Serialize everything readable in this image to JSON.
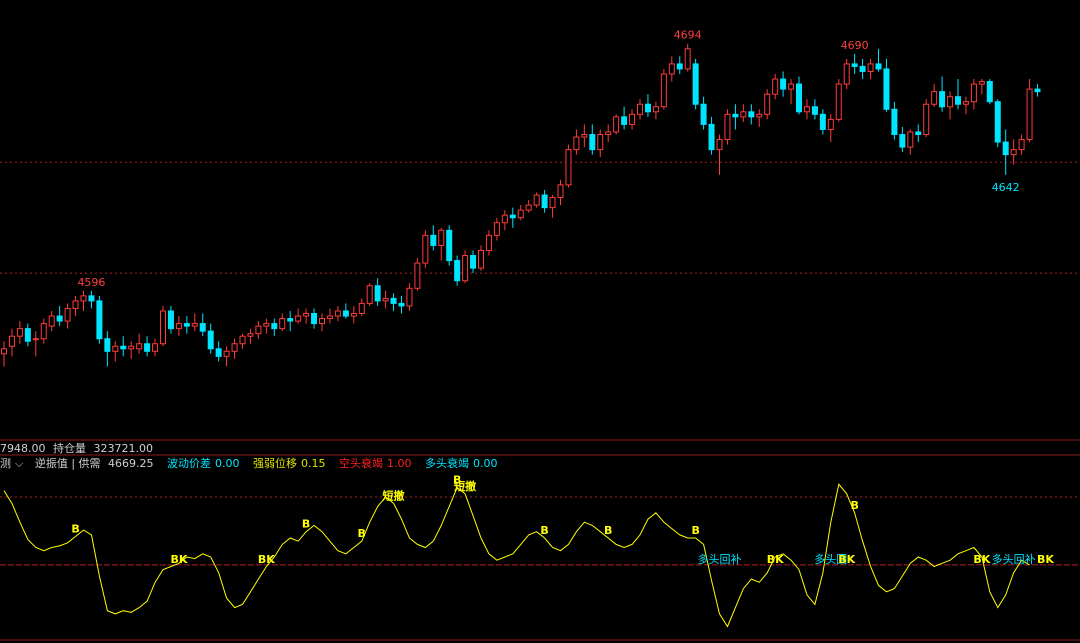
{
  "colors": {
    "background": "#000000",
    "up_candle": "#ff3b3b",
    "down_candle": "#00e5ff",
    "indicator_line": "#ffff00",
    "signal_text": "#ffff00",
    "ref_line": "#b02020",
    "label_white": "#cfcfcf",
    "label_yellow": "#e0e000",
    "label_red": "#ff2020",
    "label_cyan": "#00e5ff"
  },
  "info_bar": {
    "volume_text": "7948.00",
    "open_interest_label": "持仓量",
    "open_interest_value": "323721.00",
    "indicator_name": "测",
    "indicator_arrow": "⌵",
    "indicator_value_label": "逆振值 | 供需",
    "indicator_value": "4669.25",
    "fields": [
      {
        "label": "波动价差",
        "value": "0.00",
        "color": "#00e5ff"
      },
      {
        "label": "强弱位移",
        "value": "0.15",
        "color": "#e0e000"
      },
      {
        "label": "空头衰竭",
        "value": "1.00",
        "color": "#ff2020"
      },
      {
        "label": "多头衰竭",
        "value": "0.00",
        "color": "#00e5ff"
      }
    ]
  },
  "chart_data": [
    {
      "type": "candlestick",
      "price_range": [
        4540,
        4705
      ],
      "price_labels": [
        {
          "index": 11,
          "value": 4596,
          "text": "4596",
          "color": "#ff4040"
        },
        {
          "index": 86,
          "value": 4694,
          "text": "4694",
          "color": "#ff4040"
        },
        {
          "index": 107,
          "value": 4690,
          "text": "4690",
          "color": "#ff4040"
        },
        {
          "index": 126,
          "value": 4642,
          "text": "4642",
          "color": "#00e5ff"
        }
      ],
      "reference_lines": [
        4647,
        4603
      ],
      "candles": [
        [
          4571,
          4576,
          4566,
          4573
        ],
        [
          4574,
          4581,
          4570,
          4578
        ],
        [
          4578,
          4584,
          4575,
          4581
        ],
        [
          4581,
          4583,
          4574,
          4576
        ],
        [
          4577,
          4580,
          4570,
          4577
        ],
        [
          4577,
          4585,
          4575,
          4583
        ],
        [
          4582,
          4588,
          4580,
          4586
        ],
        [
          4586,
          4590,
          4582,
          4584
        ],
        [
          4584,
          4591,
          4581,
          4589
        ],
        [
          4589,
          4594,
          4586,
          4592
        ],
        [
          4592,
          4596,
          4588,
          4594
        ],
        [
          4594,
          4596,
          4589,
          4592
        ],
        [
          4592,
          4594,
          4575,
          4577
        ],
        [
          4577,
          4580,
          4566,
          4572
        ],
        [
          4572,
          4576,
          4568,
          4574
        ],
        [
          4574,
          4578,
          4570,
          4573
        ],
        [
          4573,
          4576,
          4569,
          4574
        ],
        [
          4573,
          4579,
          4571,
          4575
        ],
        [
          4575,
          4578,
          4570,
          4572
        ],
        [
          4572,
          4577,
          4570,
          4575
        ],
        [
          4575,
          4590,
          4574,
          4588
        ],
        [
          4588,
          4590,
          4579,
          4581
        ],
        [
          4581,
          4586,
          4578,
          4583
        ],
        [
          4583,
          4586,
          4579,
          4582
        ],
        [
          4582,
          4587,
          4580,
          4583
        ],
        [
          4583,
          4587,
          4578,
          4580
        ],
        [
          4580,
          4583,
          4571,
          4573
        ],
        [
          4573,
          4576,
          4568,
          4570
        ],
        [
          4570,
          4574,
          4566,
          4572
        ],
        [
          4572,
          4577,
          4569,
          4575
        ],
        [
          4575,
          4579,
          4573,
          4578
        ],
        [
          4578,
          4581,
          4575,
          4579
        ],
        [
          4579,
          4584,
          4577,
          4582
        ],
        [
          4582,
          4585,
          4579,
          4583
        ],
        [
          4583,
          4585,
          4578,
          4581
        ],
        [
          4581,
          4587,
          4580,
          4585
        ],
        [
          4585,
          4588,
          4580,
          4584
        ],
        [
          4584,
          4589,
          4583,
          4586
        ],
        [
          4586,
          4589,
          4583,
          4587
        ],
        [
          4587,
          4589,
          4581,
          4583
        ],
        [
          4583,
          4587,
          4580,
          4585
        ],
        [
          4585,
          4589,
          4583,
          4586
        ],
        [
          4586,
          4590,
          4584,
          4588
        ],
        [
          4588,
          4591,
          4585,
          4586
        ],
        [
          4586,
          4590,
          4583,
          4587
        ],
        [
          4587,
          4593,
          4586,
          4591
        ],
        [
          4591,
          4599,
          4590,
          4598
        ],
        [
          4598,
          4601,
          4590,
          4592
        ],
        [
          4592,
          4596,
          4589,
          4593
        ],
        [
          4593,
          4595,
          4588,
          4591
        ],
        [
          4591,
          4594,
          4587,
          4590
        ],
        [
          4590,
          4599,
          4588,
          4597
        ],
        [
          4597,
          4609,
          4596,
          4607
        ],
        [
          4607,
          4620,
          4605,
          4618
        ],
        [
          4618,
          4622,
          4612,
          4614
        ],
        [
          4614,
          4621,
          4608,
          4620
        ],
        [
          4620,
          4622,
          4606,
          4608
        ],
        [
          4608,
          4610,
          4598,
          4600
        ],
        [
          4600,
          4612,
          4599,
          4610
        ],
        [
          4610,
          4612,
          4603,
          4605
        ],
        [
          4605,
          4614,
          4604,
          4612
        ],
        [
          4612,
          4620,
          4610,
          4618
        ],
        [
          4618,
          4625,
          4616,
          4623
        ],
        [
          4623,
          4628,
          4620,
          4626
        ],
        [
          4626,
          4629,
          4621,
          4625
        ],
        [
          4625,
          4630,
          4624,
          4628
        ],
        [
          4628,
          4632,
          4627,
          4630
        ],
        [
          4630,
          4635,
          4629,
          4634
        ],
        [
          4634,
          4636,
          4627,
          4629
        ],
        [
          4629,
          4634,
          4625,
          4633
        ],
        [
          4633,
          4640,
          4630,
          4638
        ],
        [
          4638,
          4654,
          4637,
          4652
        ],
        [
          4652,
          4660,
          4650,
          4657
        ],
        [
          4657,
          4662,
          4653,
          4658
        ],
        [
          4658,
          4662,
          4650,
          4652
        ],
        [
          4652,
          4660,
          4649,
          4658
        ],
        [
          4658,
          4662,
          4655,
          4659
        ],
        [
          4659,
          4666,
          4658,
          4665
        ],
        [
          4665,
          4669,
          4660,
          4662
        ],
        [
          4662,
          4668,
          4660,
          4666
        ],
        [
          4666,
          4672,
          4664,
          4670
        ],
        [
          4670,
          4674,
          4665,
          4667
        ],
        [
          4667,
          4671,
          4664,
          4669
        ],
        [
          4669,
          4684,
          4668,
          4682
        ],
        [
          4682,
          4689,
          4679,
          4686
        ],
        [
          4686,
          4689,
          4682,
          4684
        ],
        [
          4684,
          4694,
          4683,
          4692
        ],
        [
          4686,
          4688,
          4668,
          4670
        ],
        [
          4670,
          4673,
          4660,
          4662
        ],
        [
          4662,
          4665,
          4650,
          4652
        ],
        [
          4652,
          4658,
          4642,
          4656
        ],
        [
          4656,
          4668,
          4654,
          4666
        ],
        [
          4666,
          4670,
          4660,
          4665
        ],
        [
          4665,
          4670,
          4663,
          4667
        ],
        [
          4667,
          4670,
          4662,
          4665
        ],
        [
          4665,
          4668,
          4661,
          4666
        ],
        [
          4666,
          4676,
          4664,
          4674
        ],
        [
          4674,
          4682,
          4672,
          4680
        ],
        [
          4680,
          4683,
          4673,
          4676
        ],
        [
          4676,
          4680,
          4670,
          4678
        ],
        [
          4678,
          4681,
          4666,
          4667
        ],
        [
          4667,
          4672,
          4664,
          4669
        ],
        [
          4669,
          4672,
          4664,
          4666
        ],
        [
          4666,
          4668,
          4658,
          4660
        ],
        [
          4660,
          4666,
          4655,
          4664
        ],
        [
          4664,
          4680,
          4663,
          4678
        ],
        [
          4678,
          4688,
          4676,
          4686
        ],
        [
          4686,
          4690,
          4682,
          4685
        ],
        [
          4685,
          4688,
          4680,
          4683
        ],
        [
          4683,
          4688,
          4680,
          4686
        ],
        [
          4686,
          4692,
          4683,
          4684
        ],
        [
          4684,
          4688,
          4667,
          4668
        ],
        [
          4668,
          4671,
          4656,
          4658
        ],
        [
          4658,
          4661,
          4651,
          4653
        ],
        [
          4653,
          4660,
          4650,
          4659
        ],
        [
          4659,
          4662,
          4655,
          4658
        ],
        [
          4658,
          4672,
          4657,
          4670
        ],
        [
          4670,
          4678,
          4669,
          4675
        ],
        [
          4675,
          4681,
          4667,
          4669
        ],
        [
          4669,
          4675,
          4664,
          4673
        ],
        [
          4673,
          4680,
          4668,
          4670
        ],
        [
          4670,
          4673,
          4666,
          4671
        ],
        [
          4671,
          4680,
          4668,
          4678
        ],
        [
          4678,
          4680,
          4674,
          4679
        ],
        [
          4679,
          4680,
          4670,
          4671
        ],
        [
          4671,
          4672,
          4653,
          4655
        ],
        [
          4655,
          4660,
          4642,
          4650
        ],
        [
          4650,
          4656,
          4646,
          4652
        ],
        [
          4652,
          4658,
          4650,
          4656
        ],
        [
          4656,
          4680,
          4655,
          4676
        ],
        [
          4676,
          4678,
          4673,
          4675
        ]
      ]
    },
    {
      "type": "line",
      "name": "逆振值",
      "y_range": [
        0,
        100
      ],
      "zero_line_value": 45,
      "top_ref_value": 88,
      "values": [
        92,
        84,
        72,
        61,
        56,
        54,
        56,
        57,
        59,
        63,
        67,
        64,
        38,
        16,
        14,
        16,
        15,
        18,
        22,
        34,
        42,
        44,
        46,
        50,
        49,
        52,
        50,
        40,
        24,
        18,
        20,
        28,
        36,
        44,
        50,
        58,
        62,
        60,
        66,
        70,
        66,
        60,
        54,
        52,
        56,
        60,
        72,
        82,
        88,
        84,
        74,
        62,
        58,
        56,
        60,
        70,
        82,
        94,
        90,
        76,
        62,
        52,
        48,
        50,
        52,
        58,
        64,
        66,
        62,
        56,
        54,
        58,
        66,
        72,
        70,
        66,
        62,
        58,
        56,
        58,
        64,
        74,
        78,
        72,
        68,
        64,
        62,
        62,
        58,
        35,
        14,
        6,
        18,
        30,
        36,
        34,
        40,
        50,
        52,
        48,
        42,
        26,
        20,
        40,
        72,
        96,
        90,
        78,
        60,
        44,
        32,
        28,
        30,
        38,
        46,
        50,
        48,
        44,
        46,
        48,
        52,
        54,
        56,
        50,
        28,
        18,
        26,
        40,
        48,
        45
      ],
      "signals": [
        {
          "index": 9,
          "text": "B",
          "pos": "above"
        },
        {
          "index": 22,
          "text": "BK",
          "pos": "below"
        },
        {
          "index": 33,
          "text": "BK",
          "pos": "below"
        },
        {
          "index": 38,
          "text": "B",
          "pos": "above"
        },
        {
          "index": 45,
          "text": "B",
          "pos": "above"
        },
        {
          "index": 49,
          "text": "短撤",
          "pos": "above"
        },
        {
          "index": 57,
          "text": "B",
          "pos": "above"
        },
        {
          "index": 58,
          "text": "短撤",
          "pos": "above"
        },
        {
          "index": 68,
          "text": "B",
          "pos": "above"
        },
        {
          "index": 76,
          "text": "B",
          "pos": "above"
        },
        {
          "index": 87,
          "text": "B",
          "pos": "above"
        },
        {
          "index": 97,
          "text": "BK",
          "pos": "below"
        },
        {
          "index": 107,
          "text": "B",
          "pos": "above"
        },
        {
          "index": 106,
          "text": "BK",
          "pos": "below"
        },
        {
          "index": 123,
          "text": "BK",
          "pos": "below"
        },
        {
          "index": 131,
          "text": "BK",
          "pos": "below"
        }
      ],
      "annotations": [
        {
          "index": 90,
          "text": "多头回补",
          "color": "#00e5ff"
        },
        {
          "index": 104,
          "text": "多头回",
          "color": "#00e5ff"
        },
        {
          "index": 127,
          "text": "多头回补",
          "color": "#00e5ff"
        }
      ]
    }
  ]
}
